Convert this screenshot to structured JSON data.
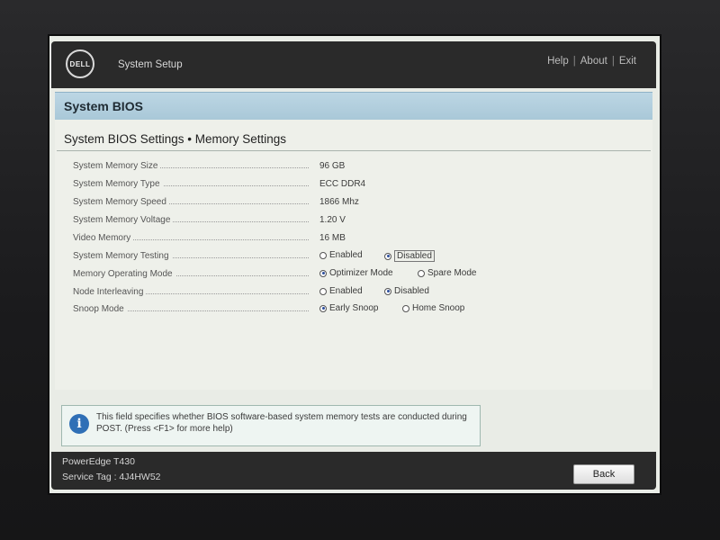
{
  "header": {
    "logo_text": "DELL",
    "app_title": "System Setup",
    "links": [
      "Help",
      "About",
      "Exit"
    ]
  },
  "section": {
    "title": "System BIOS"
  },
  "page": {
    "heading": "System BIOS Settings • Memory Settings",
    "rows": [
      {
        "label": "System Memory Size",
        "value": "96 GB"
      },
      {
        "label": "System Memory Type",
        "value": "ECC DDR4"
      },
      {
        "label": "System Memory Speed",
        "value": "1866 Mhz"
      },
      {
        "label": "System Memory Voltage",
        "value": "1.20 V"
      },
      {
        "label": "Video Memory",
        "value": "16 MB"
      },
      {
        "label": "System Memory Testing",
        "options": [
          {
            "label": "Enabled",
            "selected": false
          },
          {
            "label": "Disabled",
            "selected": true
          }
        ]
      },
      {
        "label": "Memory Operating Mode",
        "options": [
          {
            "label": "Optimizer Mode",
            "selected": true
          },
          {
            "label": "Spare Mode",
            "selected": false
          }
        ]
      },
      {
        "label": "Node Interleaving",
        "options": [
          {
            "label": "Enabled",
            "selected": false
          },
          {
            "label": "Disabled",
            "selected": true
          }
        ]
      },
      {
        "label": "Snoop Mode",
        "options": [
          {
            "label": "Early Snoop",
            "selected": true
          },
          {
            "label": "Home Snoop",
            "selected": false
          }
        ]
      }
    ]
  },
  "help": {
    "icon": "info-icon",
    "text": "This field specifies whether BIOS software-based system memory tests are conducted during POST. (Press <F1> for more help)"
  },
  "footer": {
    "model": "PowerEdge T430",
    "service_tag": "Service Tag : 4J4HW52",
    "back_label": "Back"
  },
  "colors": {
    "section_bar": "#a9c8d8",
    "topbar": "#2a2a2a",
    "radio_selected": "#2c4f9c",
    "info_icon": "#2f6fb6"
  }
}
